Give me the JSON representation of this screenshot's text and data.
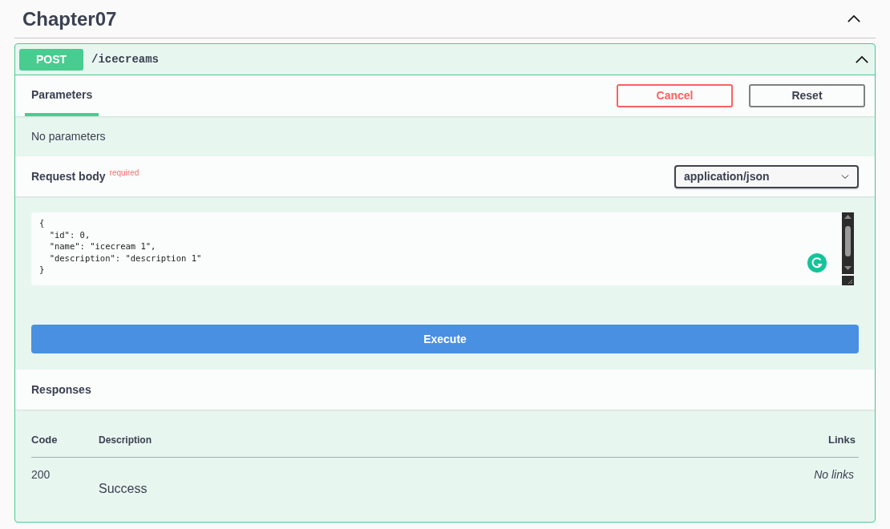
{
  "section": {
    "title": "Chapter07",
    "expanded": true
  },
  "operation": {
    "method": "POST",
    "path": "/icecreams",
    "expanded": true
  },
  "tabs": [
    {
      "label": "Parameters",
      "selected": true
    }
  ],
  "buttons": {
    "cancel": "Cancel",
    "reset": "Reset"
  },
  "parameters_note": "No parameters",
  "request_body": {
    "label": "Request body",
    "required": "required",
    "content_type": "application/json",
    "value": "{\n  \"id\": 0,\n  \"name\": \"icecream 1\",\n  \"description\": \"description 1\"\n}"
  },
  "execute": "Execute",
  "responses": {
    "title": "Responses",
    "columns": [
      "Code",
      "Description",
      "Links"
    ],
    "rows": [
      {
        "code": "200",
        "description": "Success",
        "links": "No links"
      }
    ]
  }
}
